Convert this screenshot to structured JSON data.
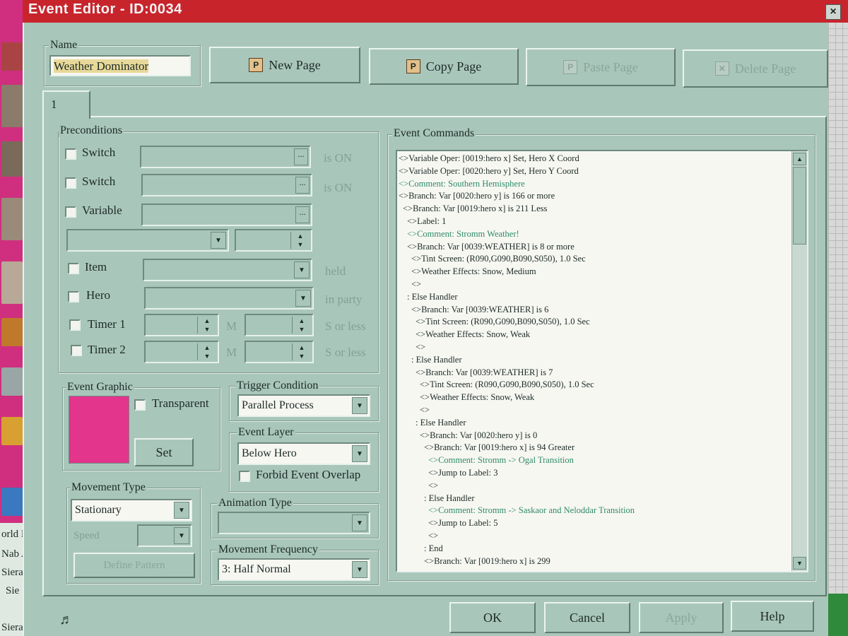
{
  "window": {
    "title": "Event Editor - ID:0034",
    "close_label": "×"
  },
  "background": {
    "tree_items": [
      "orld Map",
      "Nab A",
      "Sieralu",
      "Sie",
      "Sieralu"
    ]
  },
  "name": {
    "legend": "Name",
    "value": "Weather Dominator"
  },
  "toolbar": {
    "new_page": "New Page",
    "copy_page": "Copy Page",
    "paste_page": "Paste Page",
    "delete_page": "Delete Page"
  },
  "tabs": [
    "1"
  ],
  "preconditions": {
    "legend": "Preconditions",
    "switch1": "Switch",
    "switch1_suffix": "is ON",
    "switch2": "Switch",
    "switch2_suffix": "is ON",
    "variable": "Variable",
    "item": "Item",
    "item_suffix": "held",
    "hero": "Hero",
    "hero_suffix": "in party",
    "timer1": "Timer 1",
    "timer2": "Timer 2",
    "m_label": "M",
    "timer_suffix": "S or less",
    "ellipsis": "..."
  },
  "event_graphic": {
    "legend": "Event Graphic",
    "transparent": "Transparent",
    "set": "Set",
    "color": "#e2358b"
  },
  "trigger": {
    "legend": "Trigger Condition",
    "value": "Parallel Process"
  },
  "layer": {
    "legend": "Event Layer",
    "value": "Below Hero",
    "forbid_overlap": "Forbid Event Overlap"
  },
  "movement_type": {
    "legend": "Movement Type",
    "value": "Stationary",
    "speed": "Speed",
    "define_pattern": "Define Pattern"
  },
  "animation_type": {
    "legend": "Animation Type",
    "value": ""
  },
  "movement_frequency": {
    "legend": "Movement Frequency",
    "value": "3: Half Normal"
  },
  "event_commands": {
    "legend": "Event Commands",
    "lines": [
      {
        "indent": 0,
        "text": "<>Variable Oper: [0019:hero x] Set, Hero X Coord",
        "comment": false
      },
      {
        "indent": 0,
        "text": "<>Variable Oper: [0020:hero y] Set, Hero Y Coord",
        "comment": false
      },
      {
        "indent": 0,
        "text": "<>Comment: Southern Hemisphere",
        "comment": true
      },
      {
        "indent": 0,
        "text": "<>Branch: Var [0020:hero y] is 166 or more",
        "comment": false
      },
      {
        "indent": 1,
        "text": "<>Branch: Var [0019:hero x] is 211 Less",
        "comment": false
      },
      {
        "indent": 2,
        "text": "<>Label: 1",
        "comment": false
      },
      {
        "indent": 2,
        "text": "<>Comment: Stromm Weather!",
        "comment": true
      },
      {
        "indent": 2,
        "text": "<>Branch: Var [0039:WEATHER] is 8 or more",
        "comment": false
      },
      {
        "indent": 3,
        "text": "<>Tint Screen: (R090,G090,B090,S050), 1.0 Sec",
        "comment": false
      },
      {
        "indent": 3,
        "text": "<>Weather Effects: Snow, Medium",
        "comment": false
      },
      {
        "indent": 3,
        "text": "<>",
        "comment": false
      },
      {
        "indent": 2,
        "text": ": Else Handler",
        "comment": false
      },
      {
        "indent": 3,
        "text": "<>Branch: Var [0039:WEATHER] is 6",
        "comment": false
      },
      {
        "indent": 4,
        "text": "<>Tint Screen: (R090,G090,B090,S050), 1.0 Sec",
        "comment": false
      },
      {
        "indent": 4,
        "text": "<>Weather Effects: Snow, Weak",
        "comment": false
      },
      {
        "indent": 4,
        "text": "<>",
        "comment": false
      },
      {
        "indent": 3,
        "text": ": Else Handler",
        "comment": false
      },
      {
        "indent": 4,
        "text": "<>Branch: Var [0039:WEATHER] is 7",
        "comment": false
      },
      {
        "indent": 5,
        "text": "<>Tint Screen: (R090,G090,B090,S050), 1.0 Sec",
        "comment": false
      },
      {
        "indent": 5,
        "text": "<>Weather Effects: Snow, Weak",
        "comment": false
      },
      {
        "indent": 5,
        "text": "<>",
        "comment": false
      },
      {
        "indent": 4,
        "text": ": Else Handler",
        "comment": false
      },
      {
        "indent": 5,
        "text": "<>Branch: Var [0020:hero y] is 0",
        "comment": false
      },
      {
        "indent": 6,
        "text": "<>Branch: Var [0019:hero x] is 94 Greater",
        "comment": false
      },
      {
        "indent": 7,
        "text": "<>Comment: Stromm -> Ogal Transition",
        "comment": true
      },
      {
        "indent": 7,
        "text": "<>Jump to Label: 3",
        "comment": false
      },
      {
        "indent": 7,
        "text": "<>",
        "comment": false
      },
      {
        "indent": 6,
        "text": ": Else Handler",
        "comment": false
      },
      {
        "indent": 7,
        "text": "<>Comment: Stromm -> Saskaor and Neloddar Transition",
        "comment": true
      },
      {
        "indent": 7,
        "text": "<>Jump to Label: 5",
        "comment": false
      },
      {
        "indent": 7,
        "text": "<>",
        "comment": false
      },
      {
        "indent": 6,
        "text": ": End",
        "comment": false
      },
      {
        "indent": 6,
        "text": "<>Branch: Var [0019:hero x] is 299",
        "comment": false
      }
    ]
  },
  "footer": {
    "ok": "OK",
    "cancel": "Cancel",
    "apply": "Apply",
    "help": "Help",
    "sound_icon": "♬"
  }
}
